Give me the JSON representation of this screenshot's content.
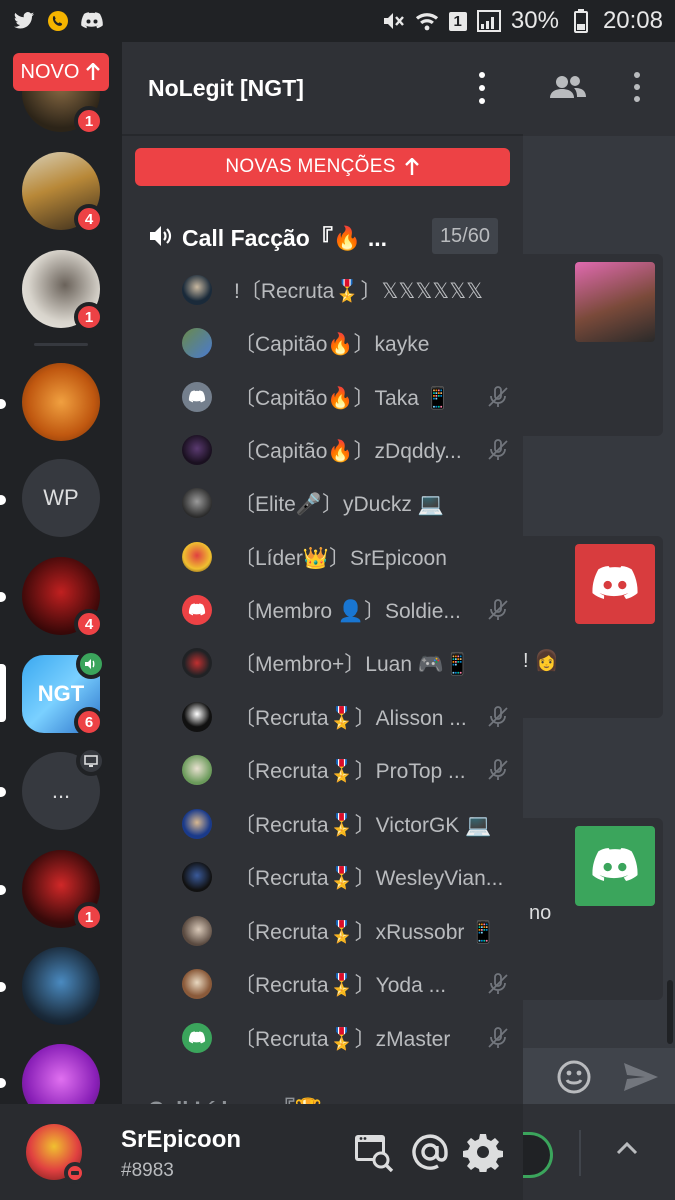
{
  "status_bar": {
    "battery": "30%",
    "time": "20:08",
    "sim_badge": "1",
    "app_icons": [
      "twitter-icon",
      "whatsapp-icon",
      "discord-icon"
    ]
  },
  "servers": {
    "novo_label": "NOVO",
    "items": [
      {
        "badge": "1"
      },
      {
        "badge": "4"
      },
      {
        "badge": "1"
      },
      {
        "badge": ""
      },
      {
        "initials": "WP",
        "badge": ""
      },
      {
        "badge": "4"
      },
      {
        "badge": "6"
      },
      {
        "initials": "...",
        "badge": ""
      },
      {
        "badge": "1"
      },
      {
        "badge": ""
      },
      {
        "badge": ""
      }
    ]
  },
  "channel_panel": {
    "server_name": "NoLegit [NGT]",
    "mentions_label": "NOVAS MENÇÕES",
    "voice_channel": {
      "name": "Call Facção『🔥 ...",
      "capacity": "15/60"
    },
    "members": [
      {
        "name": "!〔Recruta🎖️〕𝕏𝕏𝕏𝕏𝕏𝕏",
        "muted": false
      },
      {
        "name": "〔Capitão🔥〕kayke",
        "muted": false
      },
      {
        "name": "〔Capitão🔥〕Taka 📱",
        "muted": true
      },
      {
        "name": "〔Capitão🔥〕zDqddy...",
        "muted": true
      },
      {
        "name": "〔Elite🎤〕yDuckz 💻",
        "muted": false
      },
      {
        "name": "〔Líder👑〕SrEpicoon",
        "muted": false
      },
      {
        "name": "〔Membro 👤〕Soldie...",
        "muted": true
      },
      {
        "name": "〔Membro+〕Luan 🎮📱",
        "muted": false
      },
      {
        "name": "〔Recruta🎖️〕Alisson ...",
        "muted": true
      },
      {
        "name": "〔Recruta🎖️〕ProTop ...",
        "muted": true
      },
      {
        "name": "〔Recruta🎖️〕VictorGK 💻",
        "muted": false
      },
      {
        "name": "〔Recruta🎖️〕WesleyVian...",
        "muted": false
      },
      {
        "name": "〔Recruta🎖️〕xRussobr 📱",
        "muted": false
      },
      {
        "name": "〔Recruta🎖️〕Yoda ...",
        "muted": true
      },
      {
        "name": "〔Recruta🎖️〕zMaster",
        "muted": true
      }
    ],
    "next_channel": "Call Líderes『🏆 ..."
  },
  "chat_fragment": {
    "texts": [
      "! 👩",
      "no"
    ]
  },
  "user": {
    "name": "SrEpicoon",
    "tag": "#8983"
  },
  "colors": {
    "accent_red": "#ed4245",
    "blurple": "#5865f2",
    "discord_green": "#3ba55c"
  }
}
